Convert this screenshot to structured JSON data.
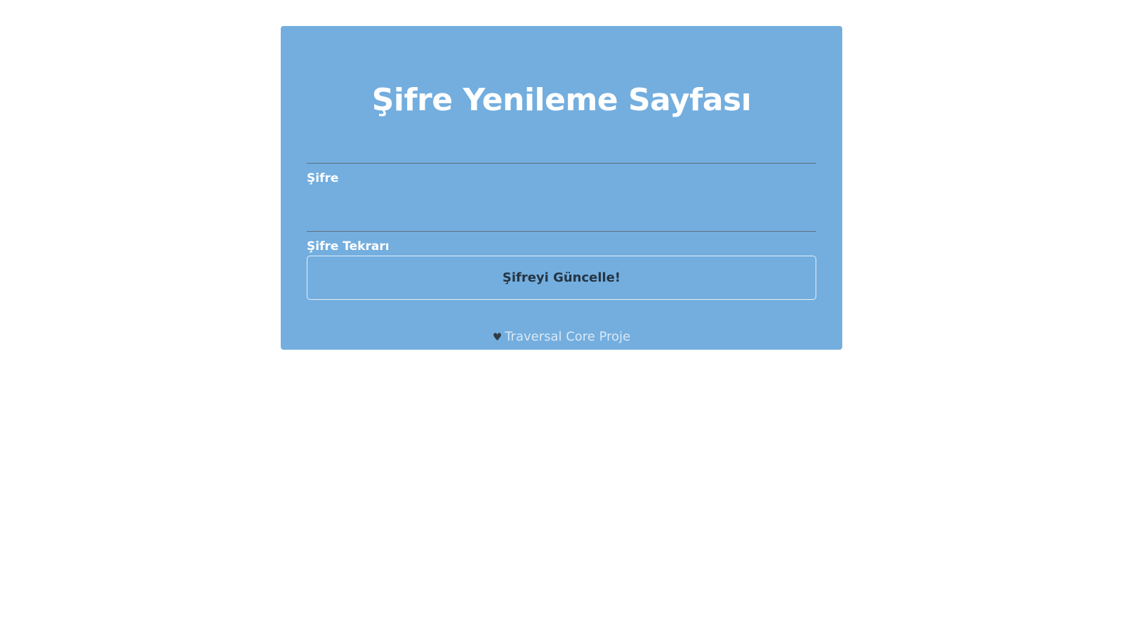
{
  "page": {
    "title": "Şifre Yenileme Sayfası"
  },
  "form": {
    "password": {
      "label": "Şifre",
      "value": "",
      "placeholder": ""
    },
    "password_repeat": {
      "label": "Şifre Tekrarı",
      "value": "",
      "placeholder": ""
    },
    "submit_label": "Şifreyi Güncelle!"
  },
  "footer": {
    "icon": "heart-icon",
    "icon_glyph": "♥",
    "link_text": "Traversal Core Proje"
  },
  "colors": {
    "card_background": "#73aedf",
    "title_text": "#ffffff",
    "button_text": "#263543",
    "page_background": "#ffffff"
  }
}
